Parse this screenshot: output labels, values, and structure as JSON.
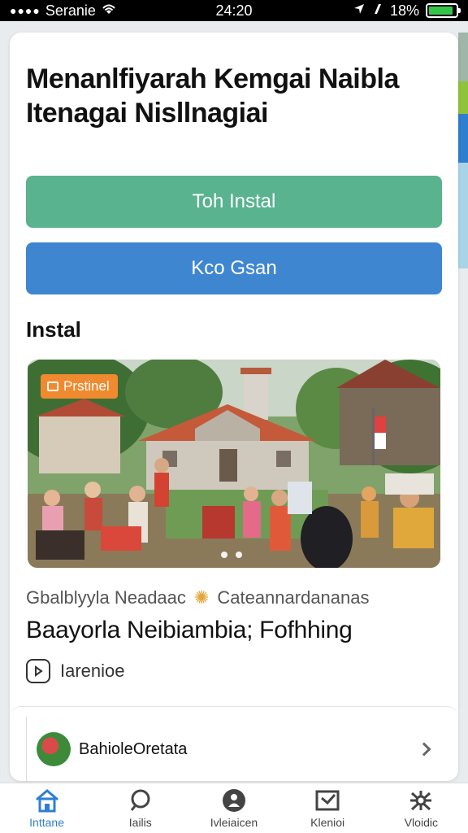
{
  "status_bar": {
    "carrier": "Seranie",
    "time": "24:20",
    "battery_percent": "18%",
    "battery_level": 0.9
  },
  "page": {
    "title": "Menanlfiyarah Kemgai Naibla Itenagai Nisllnagiai"
  },
  "buttons": {
    "primary_label": "Toh Instal",
    "secondary_label": "Kco Gsan",
    "primary_color": "#58b38e",
    "secondary_color": "#3f86d1"
  },
  "section": {
    "heading": "Instal"
  },
  "hero": {
    "badge_label": "Prstinel",
    "badge_color": "#f08a2f",
    "slide_count": 2
  },
  "article": {
    "meta_left": "Gbalblyyla Neadaac",
    "meta_right": "Cateannardananas",
    "title": "Baayorla Neibiambia; Fofhhing",
    "action_label": "Iarenioe"
  },
  "list_item": {
    "label": "BahioleOretata"
  },
  "tabs": [
    {
      "label": "Inttane",
      "icon": "home-icon",
      "active": true
    },
    {
      "label": "Iailis",
      "icon": "search-icon",
      "active": false
    },
    {
      "label": "Ivleiaicen",
      "icon": "profile-icon",
      "active": false
    },
    {
      "label": "Klenioi",
      "icon": "book-icon",
      "active": false
    },
    {
      "label": "Vloidic",
      "icon": "settings-icon",
      "active": false
    }
  ],
  "accent_color": "#2f7fd0"
}
